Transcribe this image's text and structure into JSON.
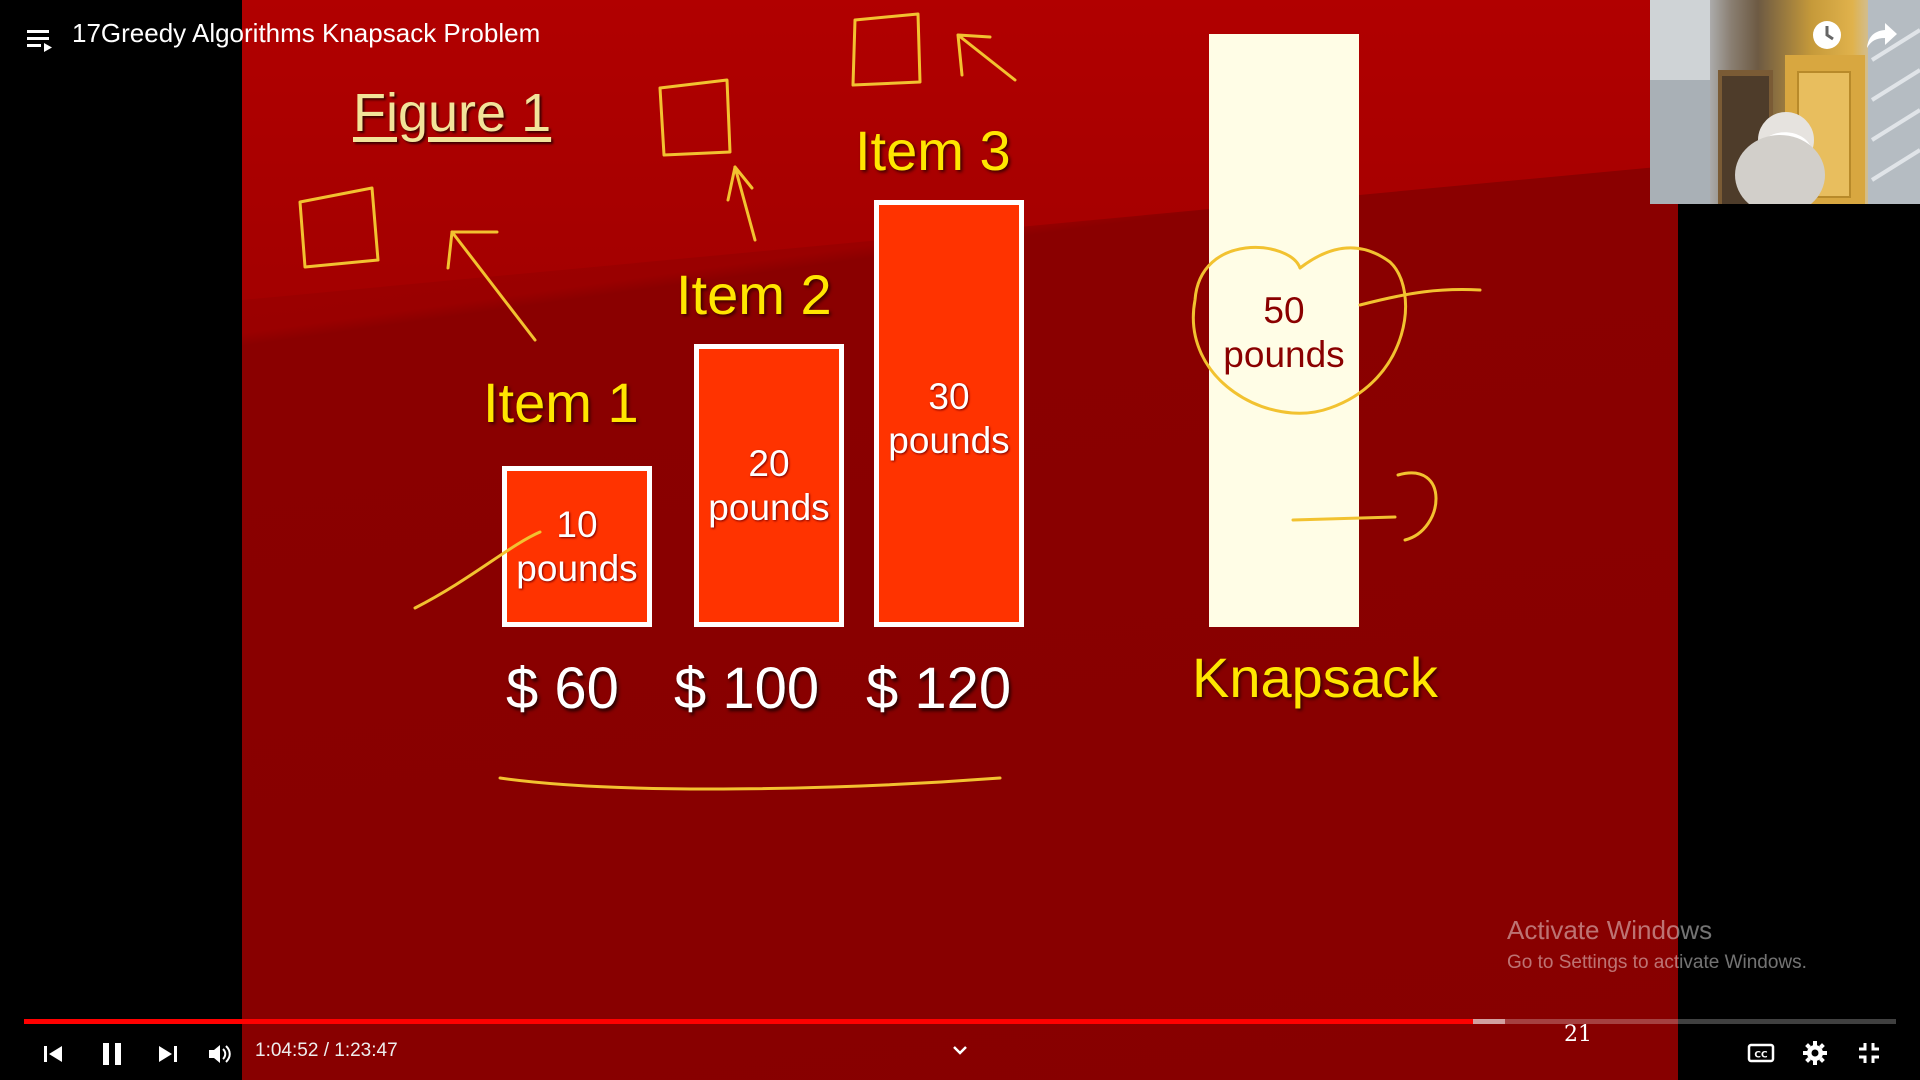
{
  "video": {
    "title": "17Greedy Algorithms Knapsack Problem",
    "current_time": "1:04:52",
    "duration": "1:23:47",
    "played_fraction": 0.7742,
    "buffered_fraction": 0.7911
  },
  "slide": {
    "figure_title": "Figure 1",
    "items": [
      {
        "label": "Item 1",
        "weight_value": "10",
        "weight_unit": "pounds",
        "price": "$ 60"
      },
      {
        "label": "Item 2",
        "weight_value": "20",
        "weight_unit": "pounds",
        "price": "$ 100"
      },
      {
        "label": "Item 3",
        "weight_value": "30",
        "weight_unit": "pounds",
        "price": "$ 120"
      }
    ],
    "knapsack": {
      "label": "Knapsack",
      "capacity_value": "50",
      "capacity_unit": "pounds"
    },
    "page_number": "21"
  },
  "watermark": {
    "line1": "Activate Windows",
    "line2": "Go to Settings to activate Windows."
  },
  "colors": {
    "slide_bg": "#8a0000",
    "item_box": "#ff3300",
    "item_label": "#ffe600",
    "knapsack_fill": "#fffde6",
    "annotation_ink": "#ffcc33",
    "progress_played": "#ff0000"
  },
  "icons": {
    "playlist": "playlist-icon",
    "watch_later": "clock-icon",
    "share": "share-icon",
    "previous": "skip-previous-icon",
    "pause": "pause-icon",
    "next": "skip-next-icon",
    "volume": "volume-icon",
    "chapters": "chevron-down-icon",
    "captions": "cc-icon",
    "settings": "gear-icon",
    "exit_fullscreen": "exit-fullscreen-icon"
  }
}
